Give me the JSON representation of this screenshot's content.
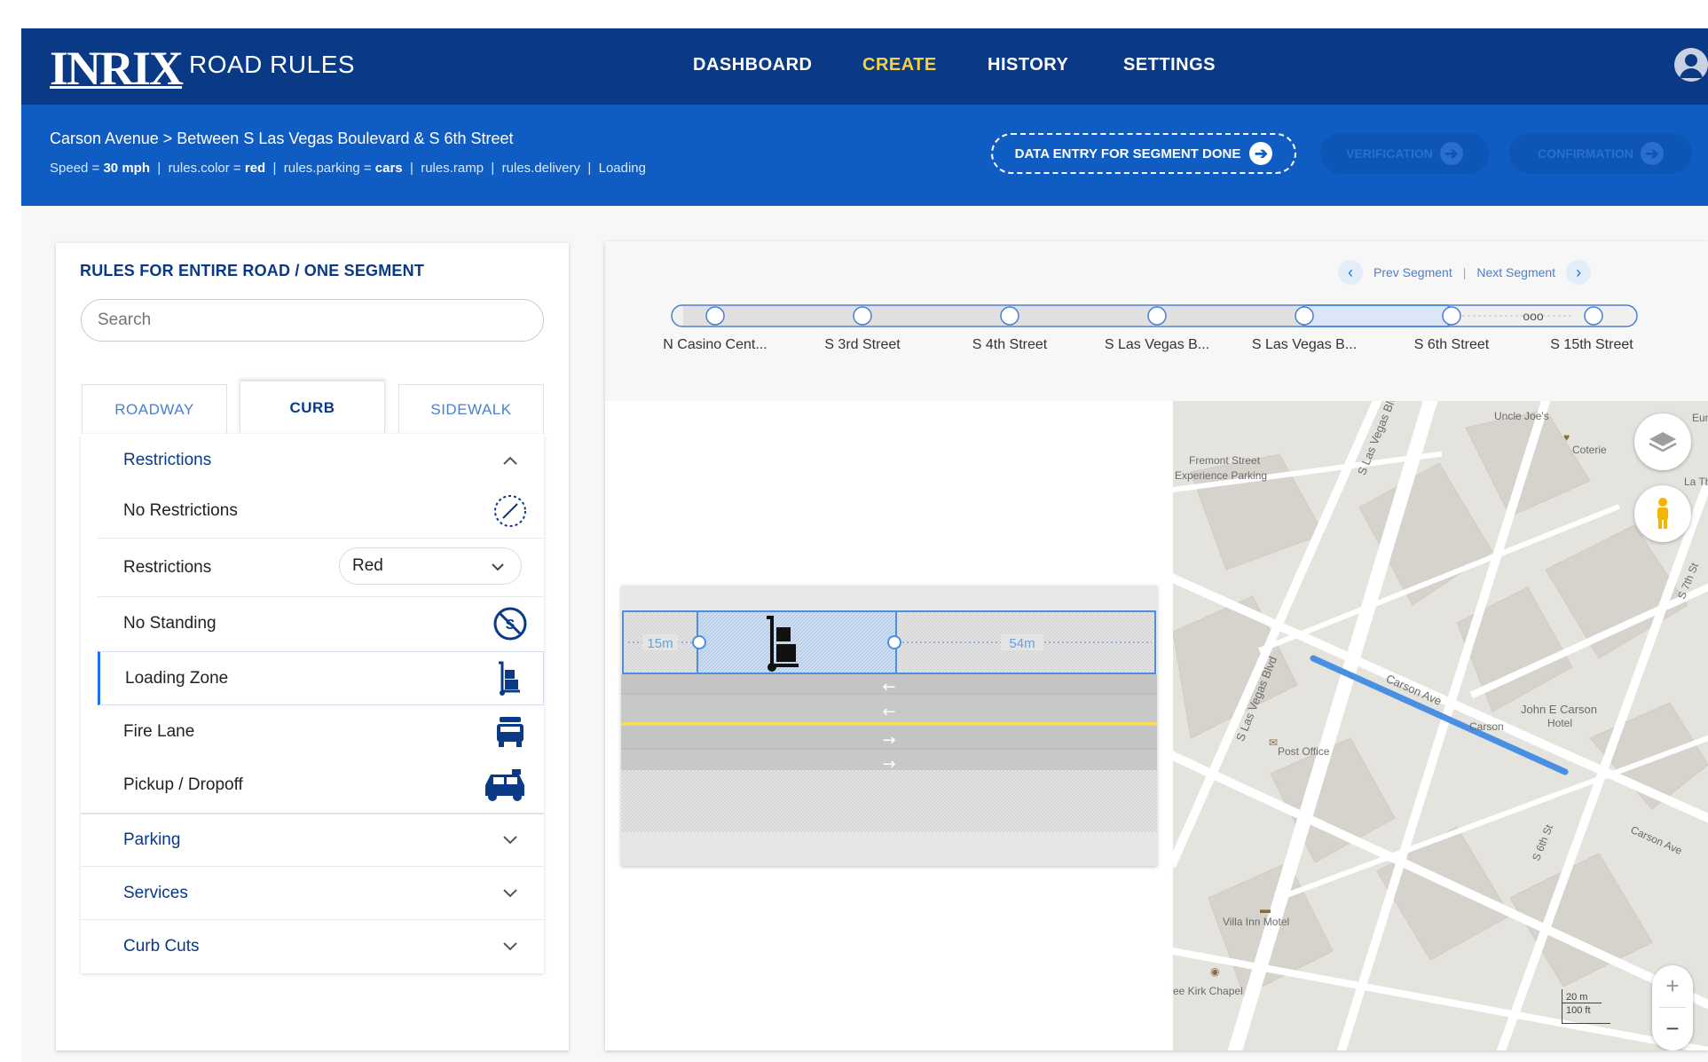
{
  "header": {
    "logo": "INRIX",
    "app_name": "ROAD RULES",
    "nav": [
      {
        "label": "DASHBOARD"
      },
      {
        "label": "CREATE"
      },
      {
        "label": "HISTORY"
      },
      {
        "label": "SETTINGS"
      }
    ],
    "active_nav": "CREATE"
  },
  "subbar": {
    "breadcrumb": "Carson Avenue > Between S Las Vegas Boulevard & S 6th Street",
    "meta": {
      "speed_label": "Speed = ",
      "speed_value": "30 mph",
      "color_label": "rules.color = ",
      "color_value": "red",
      "parking_label": "rules.parking = ",
      "parking_value": "cars",
      "ramp": "rules.ramp",
      "delivery": "rules.delivery",
      "loading": "Loading"
    },
    "done_button": "DATA ENTRY FOR SEGMENT DONE",
    "verification_button": "VERIFICATION",
    "confirmation_button": "CONFIRMATION"
  },
  "left_panel": {
    "title": "RULES FOR ENTIRE ROAD / ONE SEGMENT",
    "search_placeholder": "Search",
    "tabs": [
      {
        "label": "ROADWAY"
      },
      {
        "label": "CURB"
      },
      {
        "label": "SIDEWALK"
      }
    ],
    "active_tab": "CURB",
    "restrictions_header": "Restrictions",
    "items": {
      "no_restrictions": "No Restrictions",
      "restrictions": "Restrictions",
      "restrictions_value": "Red",
      "no_standing": "No Standing",
      "loading_zone": "Loading Zone",
      "fire_lane": "Fire Lane",
      "pickup_dropoff": "Pickup / Dropoff"
    },
    "sections": {
      "parking": "Parking",
      "services": "Services",
      "curb_cuts": "Curb Cuts"
    }
  },
  "segment_nav": {
    "prev": "Prev Segment",
    "next": "Next Segment",
    "separator": "|"
  },
  "timeline": {
    "labels": [
      "N Casino Cent...",
      "S 3rd Street",
      "S 4th Street",
      "S Las Vegas B...",
      "S Las Vegas B...",
      "S 6th Street",
      "S 15th Street"
    ],
    "ellipsis": "ooo"
  },
  "road": {
    "left_measure": "15m",
    "right_measure": "54m",
    "lane_arrows": [
      "←",
      "←",
      "→",
      "→"
    ]
  },
  "map": {
    "labels": {
      "uncle_joes": "Uncle Joe's",
      "coterie": "Coterie",
      "la_thai": "La Thai",
      "fremont_1": "Fremont Street",
      "fremont_2": "Experience Parking",
      "lv_blvd_1": "S Las Vegas Blvd",
      "lv_blvd_2": "S Las Vegas Blvd",
      "carson_ave_1": "Carson Ave",
      "carson": "Carson",
      "john_e_carson_1": "John E Carson",
      "john_e_carson_2": "Hotel",
      "post_office": "Post Office",
      "s_6th": "S 6th St",
      "carson_ave_2": "Carson Ave",
      "villa_inn": "Villa Inn Motel",
      "kirk_chapel": "ee Kirk Chapel",
      "s_7th": "S 7th St",
      "eur": "Eur",
      "scale_m": "20 m",
      "scale_ft": "100 ft"
    },
    "highlight_color": "#4a90e2"
  },
  "colors": {
    "topbar": "#0a3a86",
    "subbar": "#0f5cc2",
    "accent_active": "#f7d23b"
  }
}
